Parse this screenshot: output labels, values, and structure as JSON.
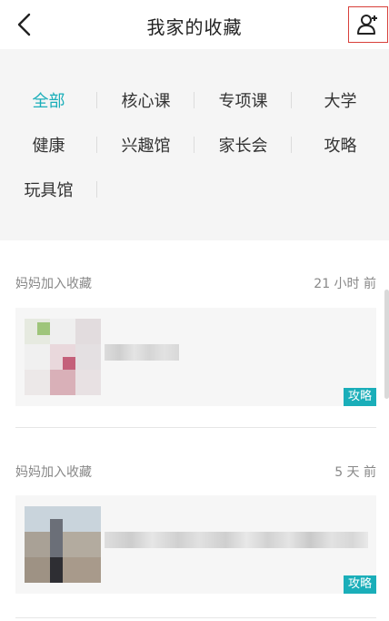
{
  "header": {
    "title": "我家的收藏",
    "back_icon": "chevron-left-icon",
    "add_member_icon": "user-plus-icon"
  },
  "filter": {
    "active_color": "#1aaeb9",
    "categories": [
      {
        "label": "全部",
        "active": true
      },
      {
        "label": "核心课",
        "active": false
      },
      {
        "label": "专项课",
        "active": false
      },
      {
        "label": "大学",
        "active": false
      },
      {
        "label": "健康",
        "active": false
      },
      {
        "label": "兴趣馆",
        "active": false
      },
      {
        "label": "家长会",
        "active": false
      },
      {
        "label": "攻略",
        "active": false
      },
      {
        "label": "玩具馆",
        "active": false
      }
    ]
  },
  "feed": [
    {
      "added_by": "妈妈加入收藏",
      "time": "21 小时 前",
      "tag": "攻略"
    },
    {
      "added_by": "妈妈加入收藏",
      "time": "5 天 前",
      "tag": "攻略"
    }
  ]
}
